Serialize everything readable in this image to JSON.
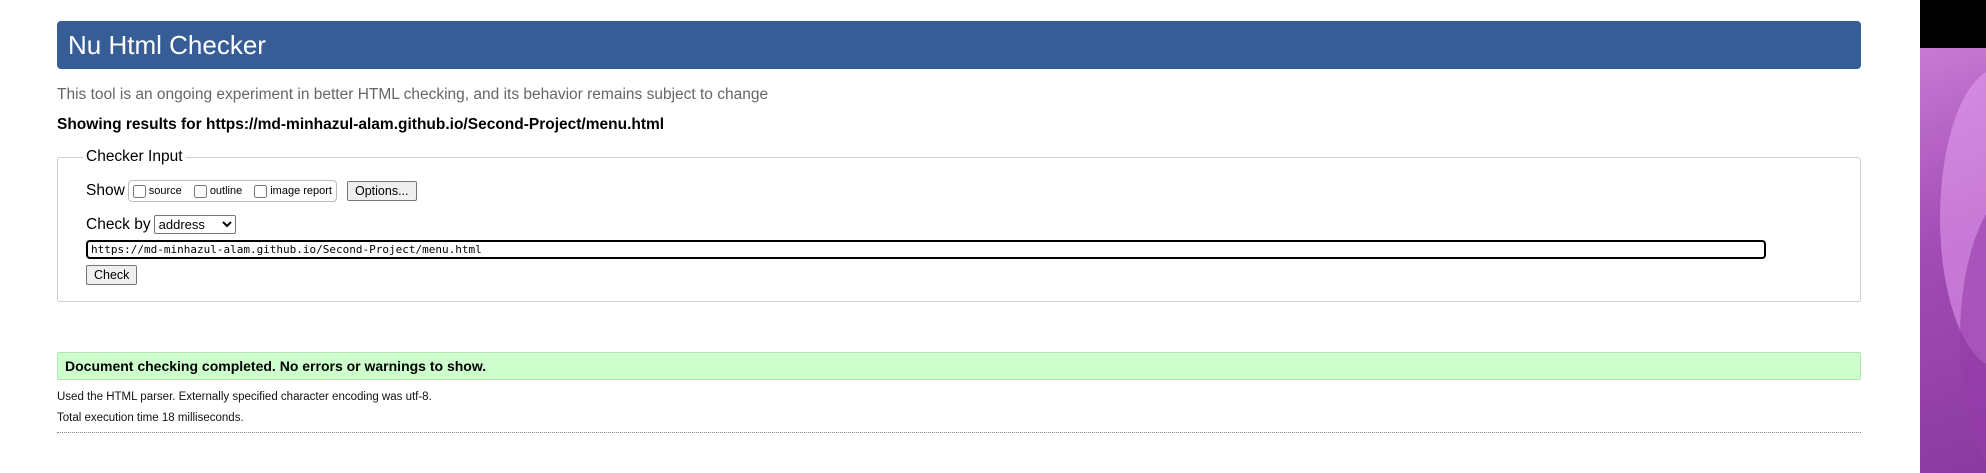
{
  "header": {
    "title": "Nu Html Checker"
  },
  "subtitle": "This tool is an ongoing experiment in better HTML checking, and its behavior remains subject to change",
  "results_for": "Showing results for https://md-minhazul-alam.github.io/Second-Project/menu.html",
  "checker_input": {
    "legend": "Checker Input",
    "show_label": "Show",
    "show_options": [
      {
        "label": "source",
        "checked": false
      },
      {
        "label": "outline",
        "checked": false
      },
      {
        "label": "image report",
        "checked": false
      }
    ],
    "options_button": "Options...",
    "check_by_label": "Check by",
    "check_by_selected": "address",
    "url_value": "https://md-minhazul-alam.github.io/Second-Project/menu.html",
    "check_button": "Check"
  },
  "result": {
    "message": "Document checking completed. No errors or warnings to show.",
    "parser_info": "Used the HTML parser. Externally specified character encoding was utf-8.",
    "execution_time": "Total execution time 18 milliseconds."
  },
  "colors": {
    "header_bg": "#365d95",
    "success_bg": "#ccffcc"
  }
}
